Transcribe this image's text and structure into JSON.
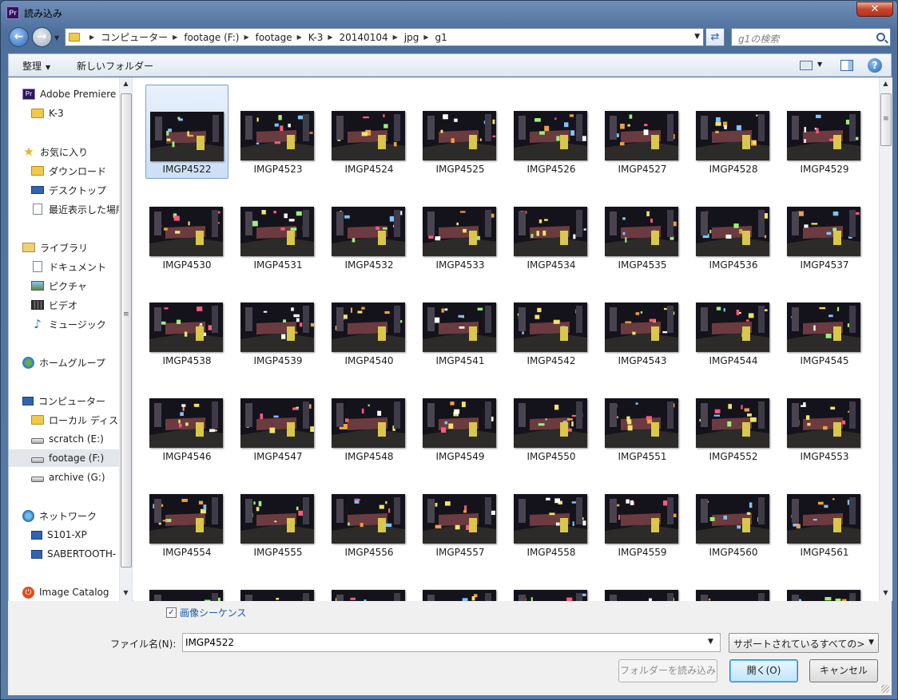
{
  "window": {
    "title": "読み込み",
    "app_icon": "Pr",
    "close_glyph": "✕"
  },
  "nav": {
    "breadcrumb": [
      "コンピューター",
      "footage (F:)",
      "footage",
      "K-3",
      "20140104",
      "jpg",
      "g1"
    ],
    "search_placeholder": "g1の検索"
  },
  "toolbar": {
    "organize": "整理",
    "new_folder": "新しいフォルダー"
  },
  "sidebar": {
    "items": [
      {
        "label": "Adobe Premiere",
        "icon": "premiere-icon",
        "indent": 0,
        "selected": false
      },
      {
        "label": "K-3",
        "icon": "folder-icon",
        "indent": 1,
        "selected": false
      },
      {
        "label": "お気に入り",
        "icon": "star-icon",
        "indent": 0,
        "selected": false
      },
      {
        "label": "ダウンロード",
        "icon": "download-folder-icon",
        "indent": 1,
        "selected": false
      },
      {
        "label": "デスクトップ",
        "icon": "desktop-icon",
        "indent": 1,
        "selected": false
      },
      {
        "label": "最近表示した場所",
        "icon": "recent-places-icon",
        "indent": 1,
        "selected": false
      },
      {
        "label": "ライブラリ",
        "icon": "library-icon",
        "indent": 0,
        "selected": false
      },
      {
        "label": "ドキュメント",
        "icon": "documents-icon",
        "indent": 1,
        "selected": false
      },
      {
        "label": "ピクチャ",
        "icon": "pictures-icon",
        "indent": 1,
        "selected": false
      },
      {
        "label": "ビデオ",
        "icon": "videos-icon",
        "indent": 1,
        "selected": false
      },
      {
        "label": "ミュージック",
        "icon": "music-icon",
        "indent": 1,
        "selected": false
      },
      {
        "label": "ホームグループ",
        "icon": "homegroup-icon",
        "indent": 0,
        "selected": false
      },
      {
        "label": "コンピューター",
        "icon": "computer-icon",
        "indent": 0,
        "selected": false
      },
      {
        "label": "ローカル ディスク",
        "icon": "local-disk-icon",
        "indent": 1,
        "selected": false
      },
      {
        "label": "scratch (E:)",
        "icon": "drive-icon",
        "indent": 1,
        "selected": false
      },
      {
        "label": "footage (F:)",
        "icon": "drive-icon",
        "indent": 1,
        "selected": true
      },
      {
        "label": "archive (G:)",
        "icon": "drive-icon",
        "indent": 1,
        "selected": false
      },
      {
        "label": "ネットワーク",
        "icon": "network-icon",
        "indent": 0,
        "selected": false
      },
      {
        "label": "S101-XP",
        "icon": "network-pc-icon",
        "indent": 1,
        "selected": false
      },
      {
        "label": "SABERTOOTH-",
        "icon": "network-pc-icon",
        "indent": 1,
        "selected": false
      },
      {
        "label": "Image Catalog",
        "icon": "image-catalog-icon",
        "indent": 0,
        "selected": false
      }
    ]
  },
  "files": {
    "selected": "IMGP4522",
    "items": [
      "IMGP4522",
      "IMGP4523",
      "IMGP4524",
      "IMGP4525",
      "IMGP4526",
      "IMGP4527",
      "IMGP4528",
      "IMGP4529",
      "IMGP4530",
      "IMGP4531",
      "IMGP4532",
      "IMGP4533",
      "IMGP4534",
      "IMGP4535",
      "IMGP4536",
      "IMGP4537",
      "IMGP4538",
      "IMGP4539",
      "IMGP4540",
      "IMGP4541",
      "IMGP4542",
      "IMGP4543",
      "IMGP4544",
      "IMGP4545",
      "IMGP4546",
      "IMGP4547",
      "IMGP4548",
      "IMGP4549",
      "IMGP4550",
      "IMGP4551",
      "IMGP4552",
      "IMGP4553",
      "IMGP4554",
      "IMGP4555",
      "IMGP4556",
      "IMGP4557",
      "IMGP4558",
      "IMGP4559",
      "IMGP4560",
      "IMGP4561",
      "",
      "",
      "",
      "",
      "",
      "",
      "",
      ""
    ]
  },
  "footer": {
    "image_sequence_label": "画像シーケンス",
    "image_sequence_checked": true,
    "filename_label": "ファイル名(N):",
    "filename_value": "IMGP4522",
    "file_type": "サポートされているすべての>",
    "import_folder": "フォルダーを読み込み",
    "open": "開く(O)",
    "cancel": "キャンセル"
  },
  "colors": {
    "selection": "#cbdff6",
    "accent": "#2a66b6",
    "link": "#1a56a8"
  }
}
